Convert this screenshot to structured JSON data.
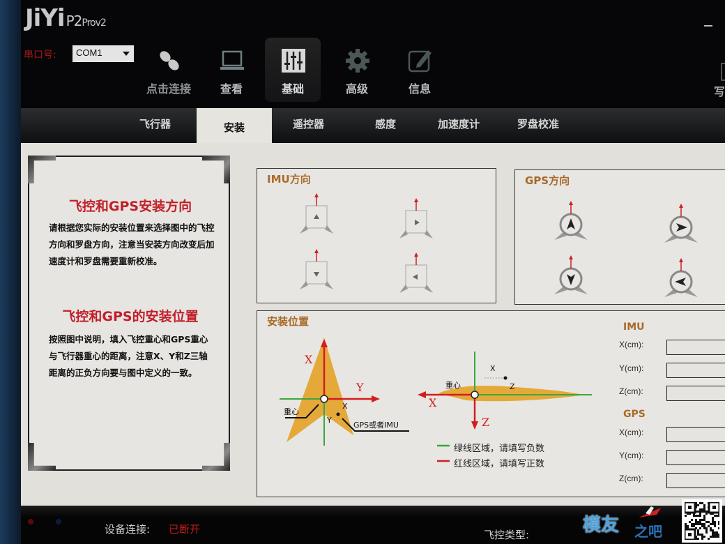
{
  "app": {
    "logo": "JiYi",
    "logo_model": "P2",
    "logo_suffix": "Prov2"
  },
  "toolbar": {
    "port_label": "串口号:",
    "port_value": "COM1",
    "nav": [
      {
        "label": "点击连接",
        "icon": "link-chain-icon",
        "active": false
      },
      {
        "label": "查看",
        "icon": "laptop-icon",
        "active": false
      },
      {
        "label": "基础",
        "icon": "sliders-icon",
        "active": true
      },
      {
        "label": "高级",
        "icon": "gear-icon",
        "active": false
      },
      {
        "label": "信息",
        "icon": "edit-icon",
        "active": false
      }
    ],
    "write_label": "写"
  },
  "tabs": [
    {
      "label": "飞行器",
      "active": false
    },
    {
      "label": "安装",
      "active": true
    },
    {
      "label": "遥控器",
      "active": false
    },
    {
      "label": "感度",
      "active": false
    },
    {
      "label": "加速度计",
      "active": false
    },
    {
      "label": "罗盘校准",
      "active": false
    }
  ],
  "info_panel": {
    "title1": "飞控和GPS安装方向",
    "text1": "请根据您实际的安装位置来选择图中的飞控方向和罗盘方向，注意当安装方向改变后加速度计和罗盘需要重新校准。",
    "title2": "飞控和GPS的安装位置",
    "text2": "按照图中说明，填入飞控重心和GPS重心与飞行器重心的距离，注意X、Y和Z三轴距离的正负方向要与图中定义的一致。"
  },
  "imu_direction": {
    "title": "IMU方向",
    "options": [
      "forward",
      "right",
      "backward",
      "left"
    ]
  },
  "gps_direction": {
    "title": "GPS方向",
    "options": [
      "forward",
      "right",
      "backward",
      "left"
    ]
  },
  "install_position": {
    "title": "安装位置",
    "diagram": {
      "axis_x": "X",
      "axis_y": "Y",
      "axis_z": "Z",
      "cg_label": "重心",
      "sensor_label": "GPS或者IMU",
      "small_x": "X",
      "small_y": "Y",
      "small_z": "Z"
    },
    "legend": [
      {
        "color": "#3aa83a",
        "text": "绿线区域，请填写负数"
      },
      {
        "color": "#d21e1e",
        "text": "红线区域，请填写正数"
      }
    ],
    "imu_section": "IMU",
    "gps_section": "GPS",
    "imu_fields": [
      {
        "label": "X(cm):",
        "value": ""
      },
      {
        "label": "Y(cm):",
        "value": ""
      },
      {
        "label": "Z(cm):",
        "value": ""
      }
    ],
    "gps_fields": [
      {
        "label": "X(cm):",
        "value": ""
      },
      {
        "label": "Y(cm):",
        "value": ""
      },
      {
        "label": "Z(cm):",
        "value": ""
      }
    ]
  },
  "status": {
    "device_label": "设备连接:",
    "device_value": "已断开",
    "fc_type_label": "飞控类型:",
    "fc_type_value": ""
  },
  "watermark": {
    "text": "模友",
    "sub": "之吧"
  },
  "colors": {
    "accent_red": "#c21f2a",
    "section_brown": "#a86a2a",
    "status_red": "#c41b1b"
  }
}
